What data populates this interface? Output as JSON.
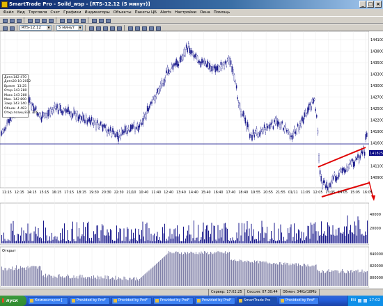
{
  "window": {
    "title": "SmartTrade Pro - Soild_wsp - [RTS-12.12 (5 минут)]",
    "buttons": [
      "_",
      "□",
      "×"
    ]
  },
  "menu": [
    "Файл",
    "Вид",
    "Торговля",
    "Счет",
    "Графики",
    "Индикаторы",
    "Объекты",
    "Пакеты ЦБ",
    "Alerts",
    "Настройки",
    "Окна",
    "Помощь"
  ],
  "toolbar2": {
    "symbol": "RTS-12.12",
    "interval": "5 минут"
  },
  "infobox": {
    "rows": [
      {
        "k": "Дата",
        "v": "142 470"
      },
      {
        "k": "Дата",
        "v": "30.10.2012"
      },
      {
        "k": "Время",
        "v": "13:25"
      },
      {
        "k": "Откр.",
        "v": "143 280"
      },
      {
        "k": "Макс.",
        "v": "143 280"
      },
      {
        "k": "Мин.",
        "v": "142 890"
      },
      {
        "k": "Закр.",
        "v": "143 140"
      },
      {
        "k": "Объем",
        "v": "4 483"
      },
      {
        "k": "Откр.позиц.",
        "v": "831 316"
      }
    ]
  },
  "price_axis": [
    "144100",
    "143800",
    "143500",
    "143300",
    "143000",
    "142700",
    "142500",
    "142200",
    "141900",
    "141600",
    "141400",
    "141100",
    "140900"
  ],
  "current_price": "141825",
  "volume_axis": [
    "40000",
    "20000"
  ],
  "oscillator_axis": [
    "840000",
    "820000",
    "800000"
  ],
  "oscillator_label": "Открыт",
  "time_axis": [
    "11:15",
    "12:15",
    "14:15",
    "15:15",
    "16:15",
    "17:15",
    "18:15",
    "19:30",
    "20:30",
    "22:30",
    "21/10",
    "10:40",
    "11:40",
    "12:40",
    "13:40",
    "14:40",
    "15:40",
    "16:40",
    "17:40",
    "18:40",
    "19:55",
    "20:55",
    "21:55",
    "01/11",
    "11:05",
    "12:05",
    "13:05",
    "14:05",
    "15:05",
    "16:05"
  ],
  "status": {
    "server": "Сервер: 17:02:25",
    "session": "Сессия: 07:30:44",
    "traffic": "Обмен: 34Kb/18Mb"
  },
  "taskbar": {
    "start": "пуск",
    "tasks": [
      "Комментарии [",
      "Provided by ProF",
      "Provided by ProF",
      "Provided by ProF",
      "Provided by ProF",
      "SmartTrade Pro",
      "Provided by ProF"
    ],
    "tray_lang": "EN",
    "clock": "17:02"
  }
}
